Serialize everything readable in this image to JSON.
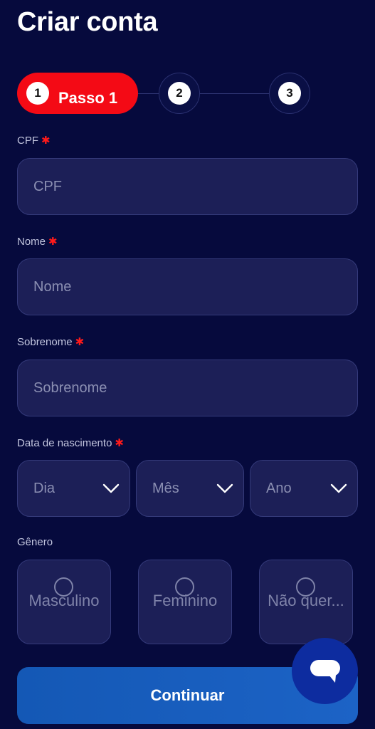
{
  "page": {
    "title": "Criar conta"
  },
  "stepper": {
    "active_number": "1",
    "active_label": "Passo 1",
    "step2_number": "2",
    "step3_number": "3"
  },
  "form": {
    "required_mark": "✱",
    "cpf": {
      "label": "CPF",
      "placeholder": "CPF",
      "value": ""
    },
    "nome": {
      "label": "Nome",
      "placeholder": "Nome",
      "value": ""
    },
    "sobrenome": {
      "label": "Sobrenome",
      "placeholder": "Sobrenome",
      "value": ""
    },
    "nascimento": {
      "label": "Data de nascimento",
      "day": "Dia",
      "month": "Mês",
      "year": "Ano"
    },
    "genero": {
      "label": "Gênero",
      "options": [
        "Masculino",
        "Feminino",
        "Não quer..."
      ]
    }
  },
  "actions": {
    "continue_label": "Continuar"
  },
  "colors": {
    "background": "#060a3d",
    "accent_red": "#f40a15",
    "primary_blue": "#1c63c6",
    "chat_blue": "#0d2c9f"
  }
}
